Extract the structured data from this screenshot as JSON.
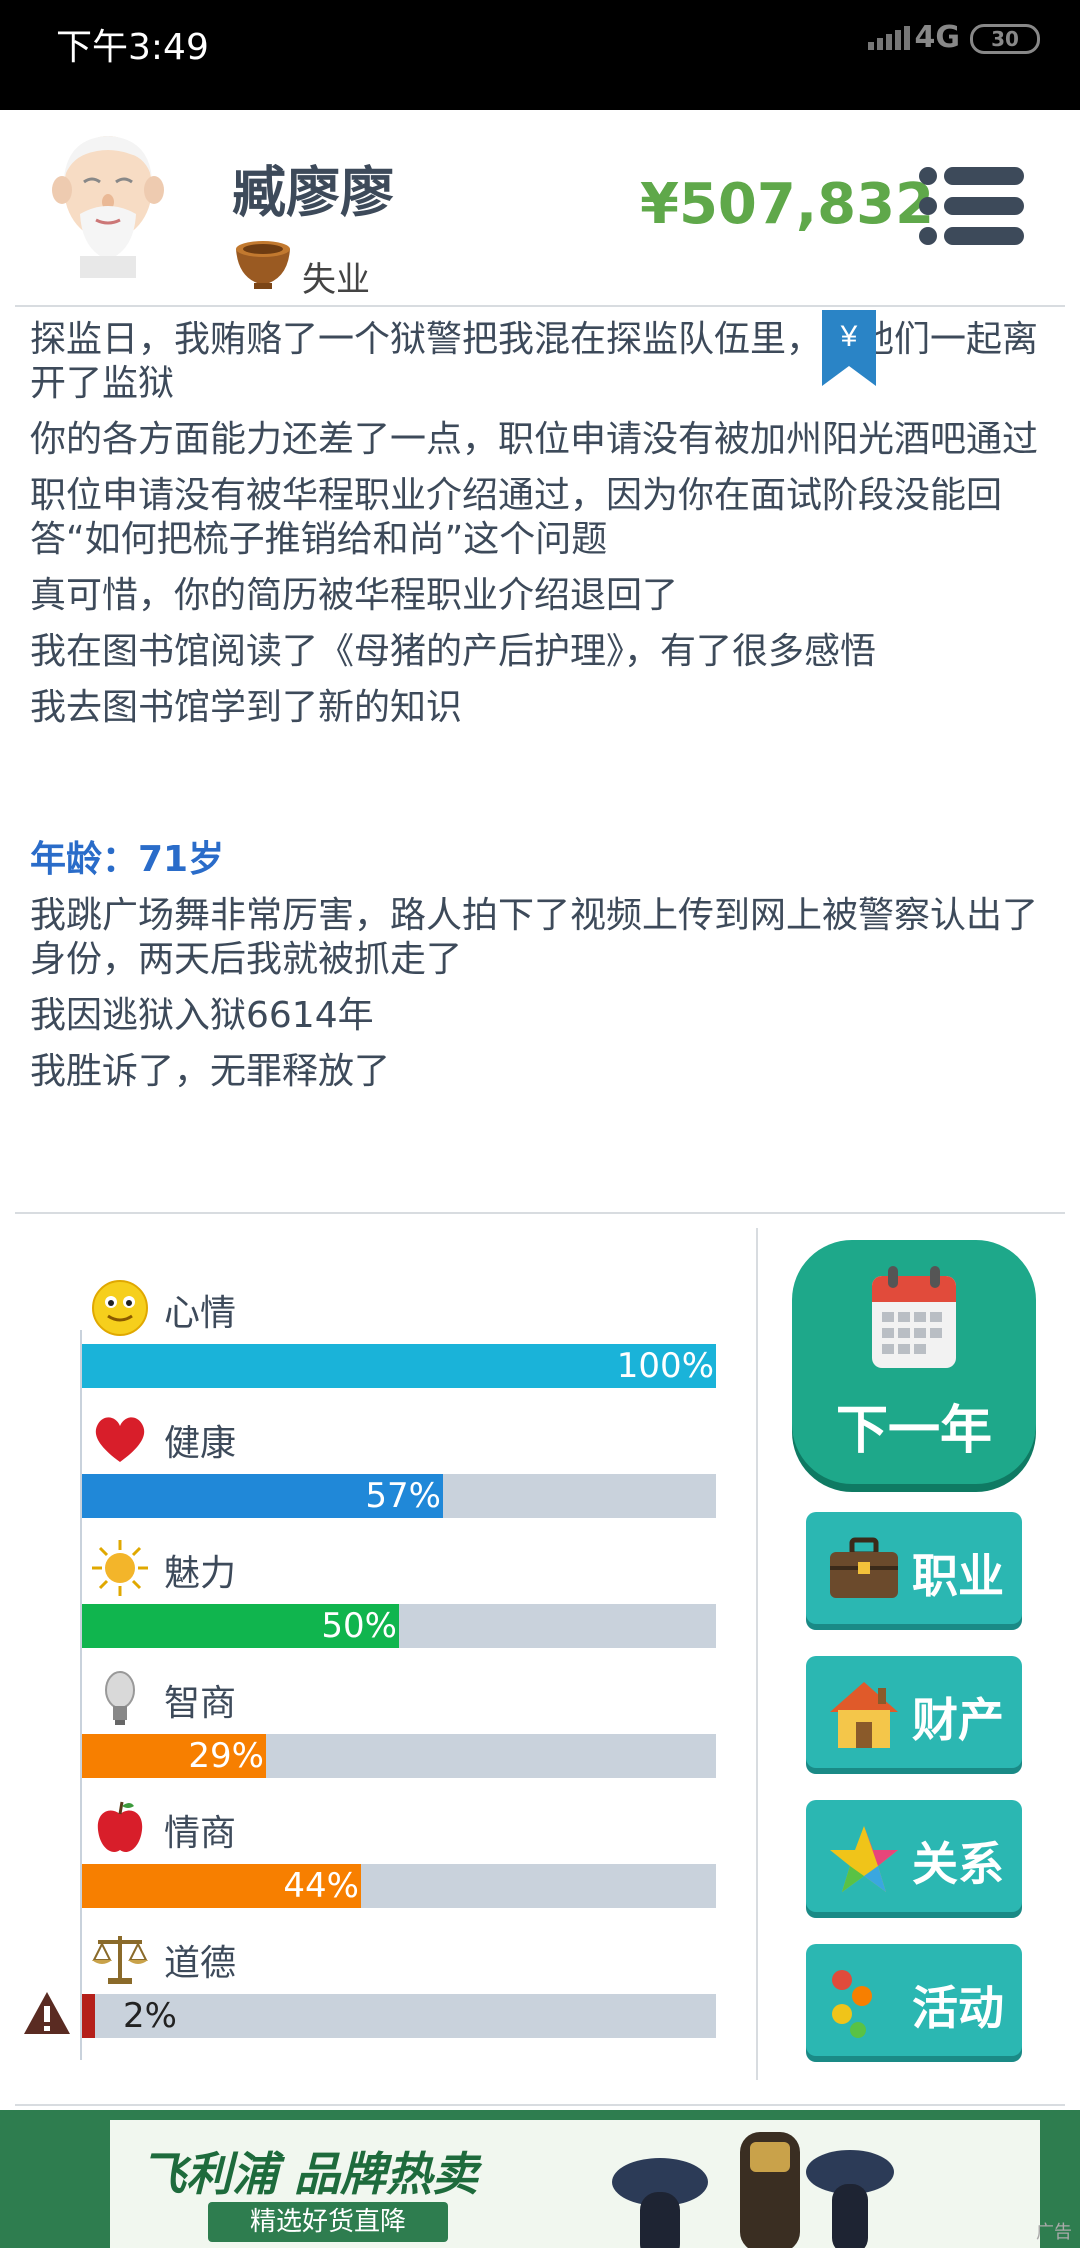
{
  "status_bar": {
    "time": "下午3:49",
    "network": "4G",
    "battery": "30"
  },
  "header": {
    "name": "臧廖廖",
    "job": "失业",
    "money": "¥507,832"
  },
  "log": {
    "lines_before": [
      "探监日，我贿赂了一个狱警把我混在探监队伍里，和他们一起离开了监狱",
      "你的各方面能力还差了一点，职位申请没有被加州阳光酒吧通过",
      "职位申请没有被华程职业介绍通过，因为你在面试阶段没能回答“如何把梳子推销给和尚”这个问题",
      "真可惜，你的简历被华程职业介绍退回了",
      "我在图书馆阅读了《母猪的产后护理》，有了很多感悟",
      "我去图书馆学到了新的知识"
    ],
    "age_label": "年龄：71岁",
    "lines_after": [
      "我跳广场舞非常厉害，路人拍下了视频上传到网上被警察认出了身份，两天后我就被抓走了",
      "我因逃狱入狱6614年",
      "我胜诉了，无罪释放了"
    ],
    "bookmark_symbol": "¥"
  },
  "stats": [
    {
      "label": "心情",
      "value": 100,
      "text": "100%",
      "color": "#1ab3d9",
      "icon": "smiley-icon"
    },
    {
      "label": "健康",
      "value": 57,
      "text": "57%",
      "color": "#2088d8",
      "icon": "heart-icon"
    },
    {
      "label": "魅力",
      "value": 50,
      "text": "50%",
      "color": "#10b54e",
      "icon": "sun-icon"
    },
    {
      "label": "智商",
      "value": 29,
      "text": "29%",
      "color": "#f77f00",
      "icon": "bulb-icon"
    },
    {
      "label": "情商",
      "value": 44,
      "text": "44%",
      "color": "#f77f00",
      "icon": "apple-icon"
    },
    {
      "label": "道德",
      "value": 2,
      "text": "2%",
      "color": "#b5201a",
      "icon": "scale-icon"
    }
  ],
  "buttons": {
    "next_year": "下一年",
    "career": "职业",
    "property": "财产",
    "relations": "关系",
    "activities": "活动"
  },
  "ad": {
    "title": "飞利浦 品牌热卖",
    "subtitle": "精选好货直降",
    "tag": "广告"
  }
}
